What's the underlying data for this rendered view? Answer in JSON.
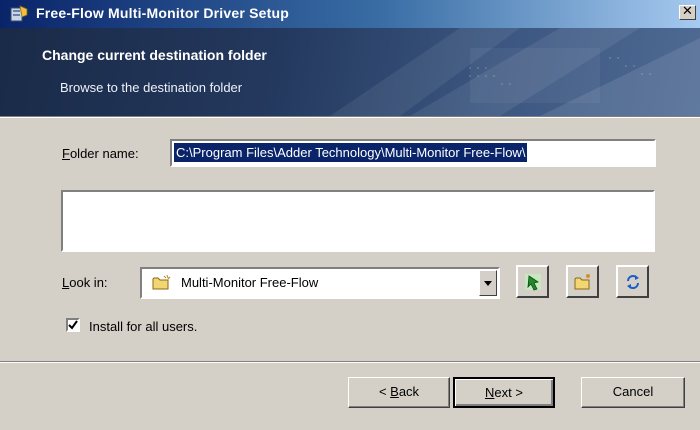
{
  "window": {
    "title": "Free-Flow Multi-Monitor Driver Setup",
    "close_glyph": "✕"
  },
  "banner": {
    "title": "Change current destination folder",
    "subtitle": "Browse to the destination folder"
  },
  "folder": {
    "label_hotkey": "F",
    "label_rest": "older name:",
    "value": "C:\\Program Files\\Adder Technology\\Multi-Monitor Free-Flow\\"
  },
  "lookin": {
    "label_hotkey": "L",
    "label_rest": "ook in:",
    "selected": "Multi-Monitor Free-Flow",
    "icons": [
      "up-one-level-icon",
      "new-folder-icon",
      "refresh-icon"
    ]
  },
  "checkbox": {
    "label": "Install for all users.",
    "checked": true
  },
  "buttons": {
    "back_prefix": "< ",
    "back_hotkey": "B",
    "back_rest": "ack",
    "next_hotkey": "N",
    "next_rest": "ext >",
    "cancel": "Cancel"
  },
  "colors": {
    "titlebar": "#0a246a",
    "banner": "#24395e",
    "selection": "#0a246a",
    "face": "#d4d0c8"
  }
}
